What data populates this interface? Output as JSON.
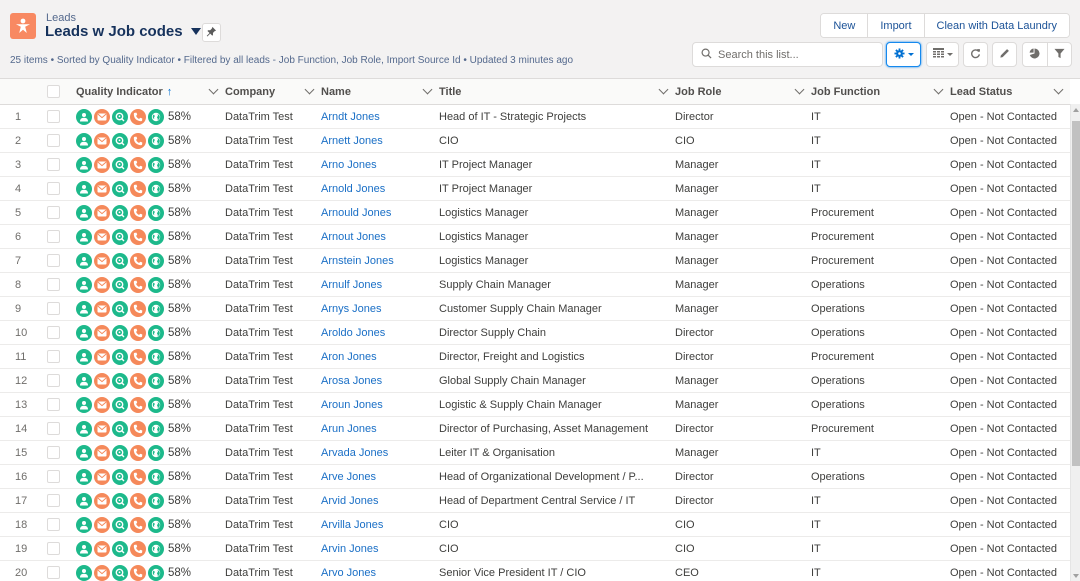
{
  "header": {
    "object_label": "Leads",
    "list_title": "Leads w Job codes",
    "meta": "25 items • Sorted by Quality Indicator • Filtered by all leads - Job Function, Job Role, Import Source Id • Updated 3 minutes ago",
    "icons": {
      "app": "lead-person-icon",
      "pin": "pin-icon"
    }
  },
  "actions": {
    "new_label": "New",
    "import_label": "Import",
    "clean_label": "Clean with Data Laundry"
  },
  "toolbar": {
    "search_placeholder": "Search this list...",
    "search_value": "",
    "buttons": [
      "settings-gear-icon",
      "table-display-icon",
      "refresh-icon",
      "edit-pencil-icon",
      "chart-icon",
      "filter-icon"
    ]
  },
  "colors": {
    "brand_orange": "#f88962",
    "link_blue": "#0070d2",
    "quality_green": "#1db98b",
    "quality_orange": "#f5895a"
  },
  "table": {
    "columns": [
      {
        "label": "Quality Indicator",
        "sorted": "ascending",
        "sort_icon": "↑"
      },
      {
        "label": "Company"
      },
      {
        "label": "Name"
      },
      {
        "label": "Title"
      },
      {
        "label": "Job Role"
      },
      {
        "label": "Job Function"
      },
      {
        "label": "Lead Status"
      }
    ],
    "quality_icons": [
      {
        "name": "person-icon",
        "color": "green"
      },
      {
        "name": "email-icon",
        "color": "orange"
      },
      {
        "name": "address-search-icon",
        "color": "green"
      },
      {
        "name": "phone-icon",
        "color": "orange"
      },
      {
        "name": "website-globe-icon",
        "color": "green"
      }
    ],
    "rows": [
      {
        "num": "1",
        "quality": "58%",
        "company": "DataTrim Test",
        "name": "Arndt Jones",
        "title": "Head of IT - Strategic Projects",
        "job_role": "Director",
        "job_function": "IT",
        "status": "Open - Not Contacted"
      },
      {
        "num": "2",
        "quality": "58%",
        "company": "DataTrim Test",
        "name": "Arnett Jones",
        "title": "CIO",
        "job_role": "CIO",
        "job_function": "IT",
        "status": "Open - Not Contacted"
      },
      {
        "num": "3",
        "quality": "58%",
        "company": "DataTrim Test",
        "name": "Arno Jones",
        "title": "IT Project Manager",
        "job_role": "Manager",
        "job_function": "IT",
        "status": "Open - Not Contacted"
      },
      {
        "num": "4",
        "quality": "58%",
        "company": "DataTrim Test",
        "name": "Arnold Jones",
        "title": "IT Project Manager",
        "job_role": "Manager",
        "job_function": "IT",
        "status": "Open - Not Contacted"
      },
      {
        "num": "5",
        "quality": "58%",
        "company": "DataTrim Test",
        "name": "Arnould Jones",
        "title": "Logistics Manager",
        "job_role": "Manager",
        "job_function": "Procurement",
        "status": "Open - Not Contacted"
      },
      {
        "num": "6",
        "quality": "58%",
        "company": "DataTrim Test",
        "name": "Arnout Jones",
        "title": "Logistics Manager",
        "job_role": "Manager",
        "job_function": "Procurement",
        "status": "Open - Not Contacted"
      },
      {
        "num": "7",
        "quality": "58%",
        "company": "DataTrim Test",
        "name": "Arnstein Jones",
        "title": "Logistics Manager",
        "job_role": "Manager",
        "job_function": "Procurement",
        "status": "Open - Not Contacted"
      },
      {
        "num": "8",
        "quality": "58%",
        "company": "DataTrim Test",
        "name": "Arnulf Jones",
        "title": "Supply Chain Manager",
        "job_role": "Manager",
        "job_function": "Operations",
        "status": "Open - Not Contacted"
      },
      {
        "num": "9",
        "quality": "58%",
        "company": "DataTrim Test",
        "name": "Arnys Jones",
        "title": "Customer Supply Chain Manager",
        "job_role": "Manager",
        "job_function": "Operations",
        "status": "Open - Not Contacted"
      },
      {
        "num": "10",
        "quality": "58%",
        "company": "DataTrim Test",
        "name": "Aroldo Jones",
        "title": "Director Supply Chain",
        "job_role": "Director",
        "job_function": "Operations",
        "status": "Open - Not Contacted"
      },
      {
        "num": "11",
        "quality": "58%",
        "company": "DataTrim Test",
        "name": "Aron Jones",
        "title": "Director, Freight and Logistics",
        "job_role": "Director",
        "job_function": "Procurement",
        "status": "Open - Not Contacted"
      },
      {
        "num": "12",
        "quality": "58%",
        "company": "DataTrim Test",
        "name": "Arosa Jones",
        "title": "Global Supply Chain Manager",
        "job_role": "Manager",
        "job_function": "Operations",
        "status": "Open - Not Contacted"
      },
      {
        "num": "13",
        "quality": "58%",
        "company": "DataTrim Test",
        "name": "Aroun Jones",
        "title": "Logistic & Supply Chain Manager",
        "job_role": "Manager",
        "job_function": "Operations",
        "status": "Open - Not Contacted"
      },
      {
        "num": "14",
        "quality": "58%",
        "company": "DataTrim Test",
        "name": "Arun Jones",
        "title": "Director of Purchasing, Asset Management",
        "job_role": "Director",
        "job_function": "Procurement",
        "status": "Open - Not Contacted"
      },
      {
        "num": "15",
        "quality": "58%",
        "company": "DataTrim Test",
        "name": "Arvada Jones",
        "title": "Leiter IT & Organisation",
        "job_role": "Manager",
        "job_function": "IT",
        "status": "Open - Not Contacted"
      },
      {
        "num": "16",
        "quality": "58%",
        "company": "DataTrim Test",
        "name": "Arve Jones",
        "title": "Head of Organizational Development / P...",
        "job_role": "Director",
        "job_function": "Operations",
        "status": "Open - Not Contacted"
      },
      {
        "num": "17",
        "quality": "58%",
        "company": "DataTrim Test",
        "name": "Arvid Jones",
        "title": "Head of Department Central Service / IT",
        "job_role": "Director",
        "job_function": "IT",
        "status": "Open - Not Contacted"
      },
      {
        "num": "18",
        "quality": "58%",
        "company": "DataTrim Test",
        "name": "Arvilla Jones",
        "title": "CIO",
        "job_role": "CIO",
        "job_function": "IT",
        "status": "Open - Not Contacted"
      },
      {
        "num": "19",
        "quality": "58%",
        "company": "DataTrim Test",
        "name": "Arvin Jones",
        "title": "CIO",
        "job_role": "CIO",
        "job_function": "IT",
        "status": "Open - Not Contacted"
      },
      {
        "num": "20",
        "quality": "58%",
        "company": "DataTrim Test",
        "name": "Arvo Jones",
        "title": "Senior Vice President IT / CIO",
        "job_role": "CEO",
        "job_function": "IT",
        "status": "Open - Not Contacted"
      }
    ]
  }
}
